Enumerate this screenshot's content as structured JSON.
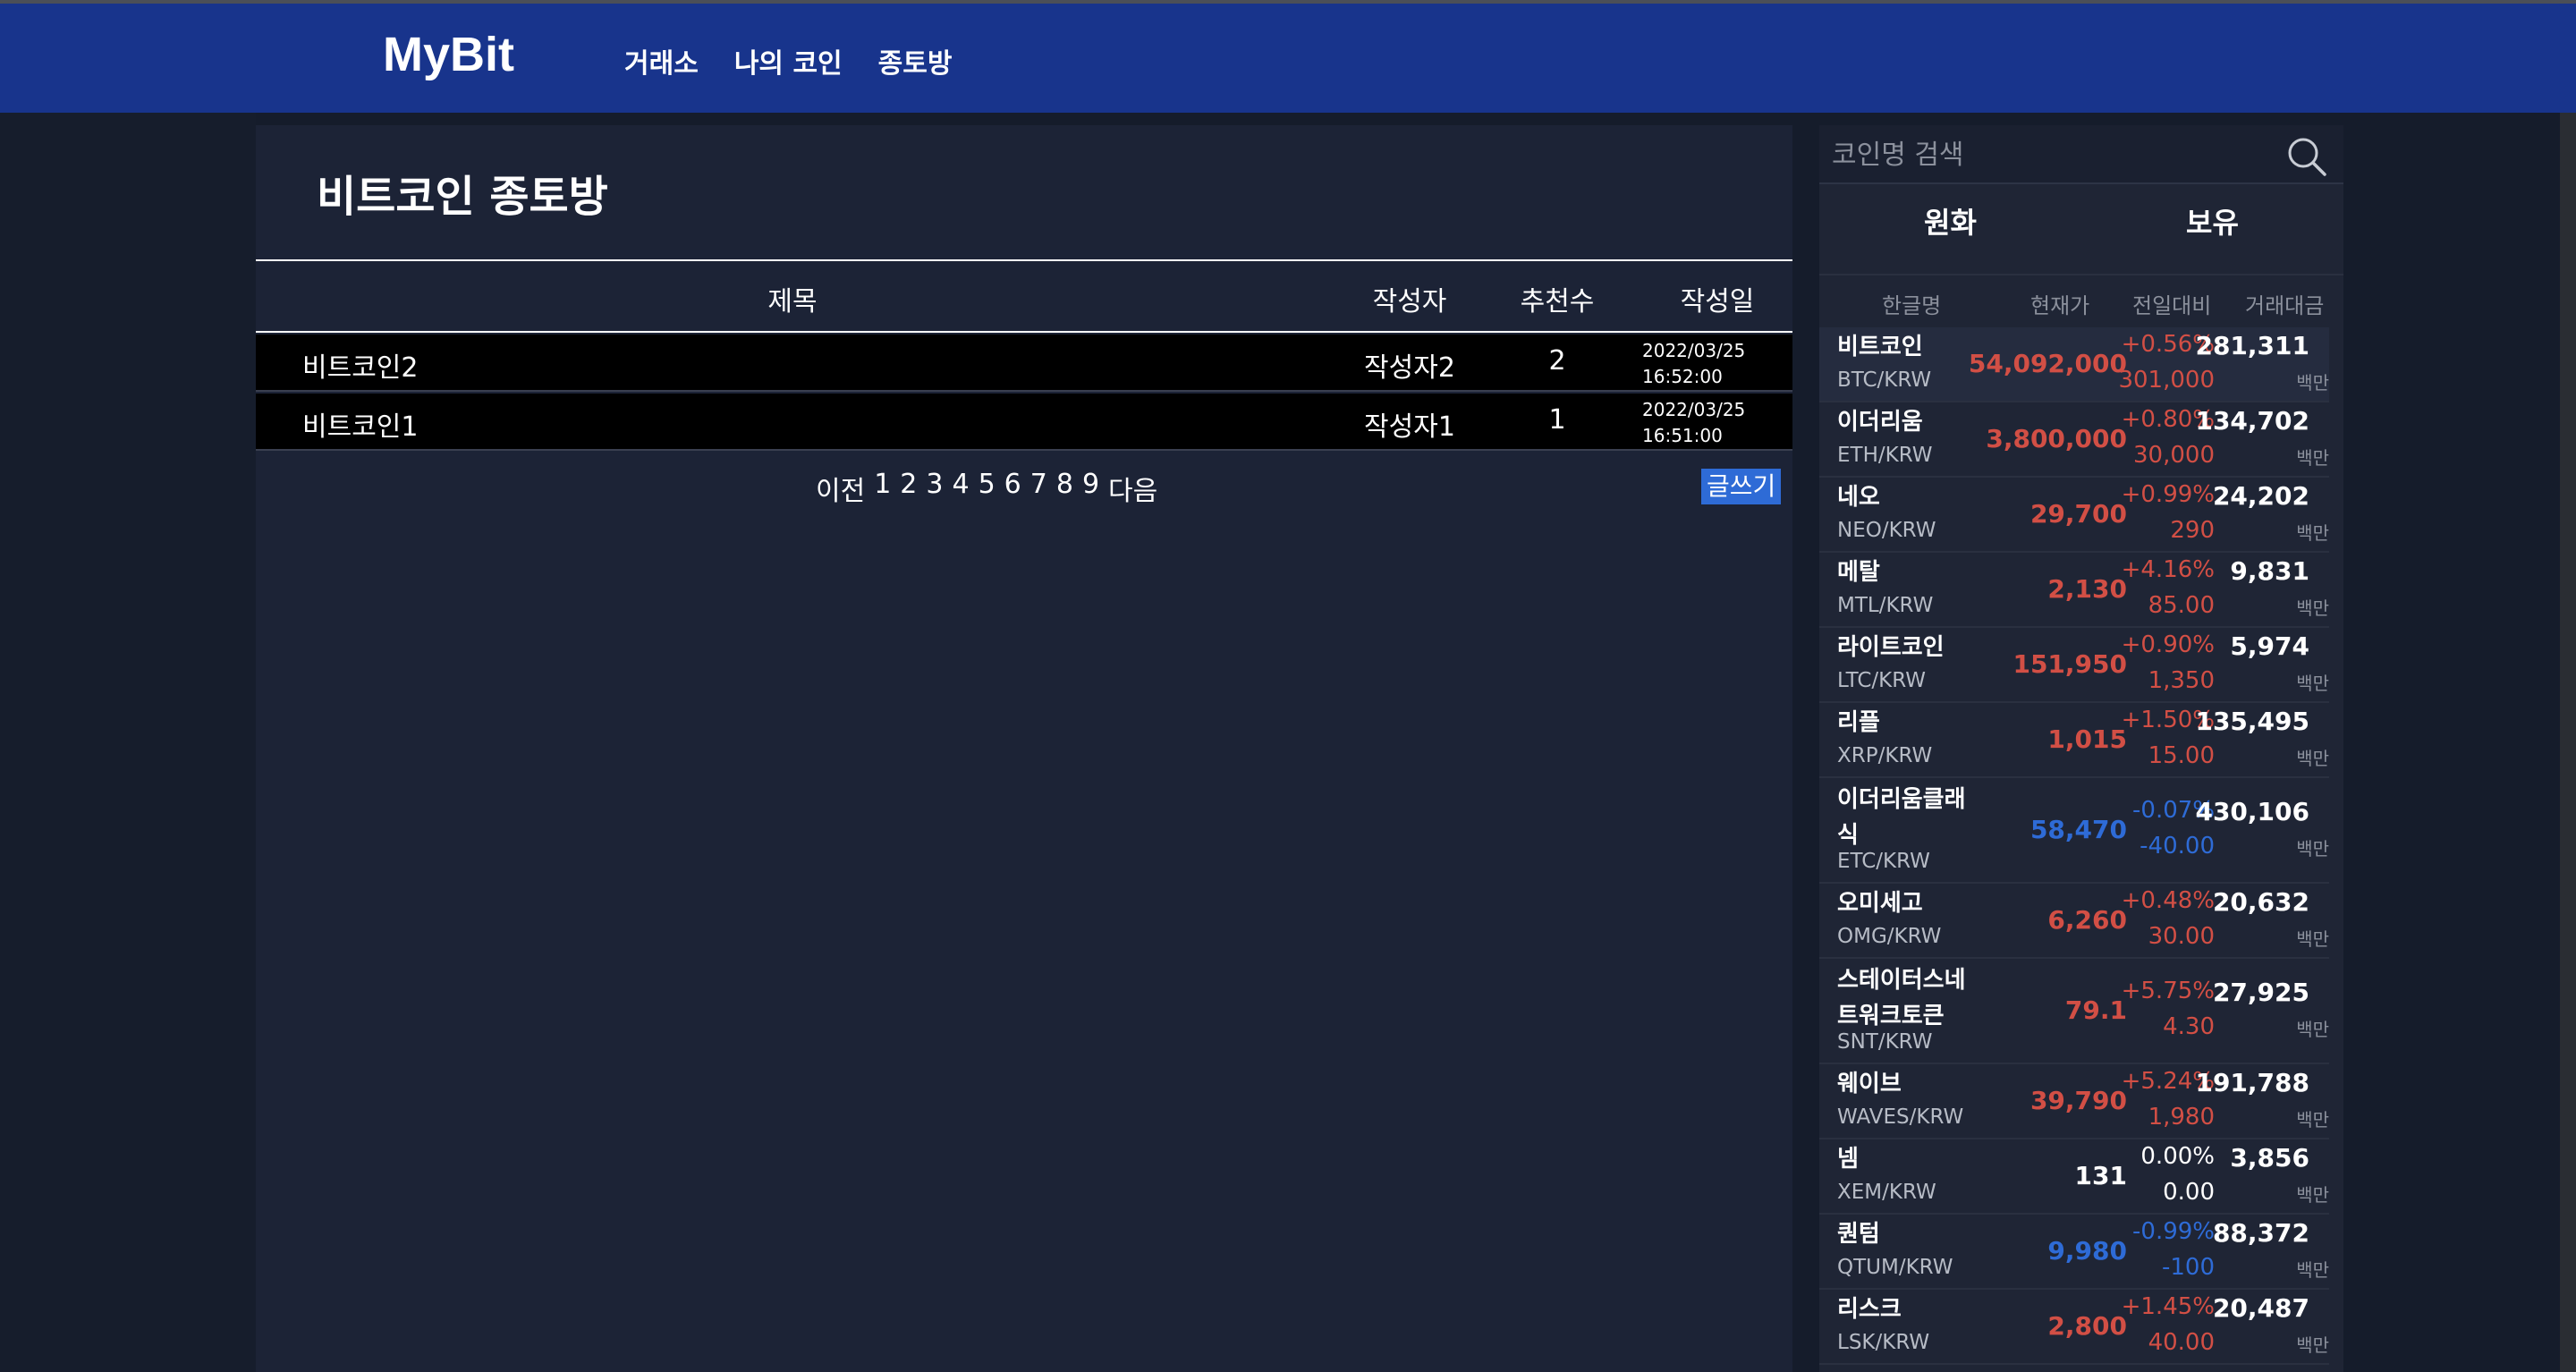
{
  "header": {
    "logo": "MyBit",
    "nav": [
      {
        "label": "거래소"
      },
      {
        "label": "나의 코인"
      },
      {
        "label": "종토방"
      }
    ]
  },
  "board": {
    "title": "비트코인 종토방",
    "columns": {
      "title": "제목",
      "author": "작성자",
      "likes": "추천수",
      "date": "작성일"
    },
    "posts": [
      {
        "title": "비트코인2",
        "author": "작성자2",
        "likes": "2",
        "date": "2022/03/25",
        "time": "16:52:00"
      },
      {
        "title": "비트코인1",
        "author": "작성자1",
        "likes": "1",
        "date": "2022/03/25",
        "time": "16:51:00"
      }
    ],
    "pager": {
      "prev": "이전",
      "pages": [
        "1",
        "2",
        "3",
        "4",
        "5",
        "6",
        "7",
        "8",
        "9"
      ],
      "next": "다음"
    },
    "write_label": "글쓰기"
  },
  "sidebar": {
    "search_placeholder": "코인명 검색",
    "tabs": [
      "원화",
      "보유"
    ],
    "columns": {
      "name": "한글명",
      "price": "현재가",
      "change": "전일대비",
      "volume": "거래대금"
    },
    "coins": [
      {
        "name": "비트코인",
        "symbol": "BTC/KRW",
        "price": "54,092,000",
        "pct": "+0.56%",
        "diff": "301,000",
        "vol": "281,311",
        "unit": "백만",
        "trend": "up"
      },
      {
        "name": "이더리움",
        "symbol": "ETH/KRW",
        "price": "3,800,000",
        "pct": "+0.80%",
        "diff": "30,000",
        "vol": "134,702",
        "unit": "백만",
        "trend": "up"
      },
      {
        "name": "네오",
        "symbol": "NEO/KRW",
        "price": "29,700",
        "pct": "+0.99%",
        "diff": "290",
        "vol": "24,202",
        "unit": "백만",
        "trend": "up"
      },
      {
        "name": "메탈",
        "symbol": "MTL/KRW",
        "price": "2,130",
        "pct": "+4.16%",
        "diff": "85.00",
        "vol": "9,831",
        "unit": "백만",
        "trend": "up"
      },
      {
        "name": "라이트코인",
        "symbol": "LTC/KRW",
        "price": "151,950",
        "pct": "+0.90%",
        "diff": "1,350",
        "vol": "5,974",
        "unit": "백만",
        "trend": "up"
      },
      {
        "name": "리플",
        "symbol": "XRP/KRW",
        "price": "1,015",
        "pct": "+1.50%",
        "diff": "15.00",
        "vol": "135,495",
        "unit": "백만",
        "trend": "up"
      },
      {
        "name": "이더리움클래식",
        "symbol": "ETC/KRW",
        "price": "58,470",
        "pct": "-0.07%",
        "diff": "-40.00",
        "vol": "430,106",
        "unit": "백만",
        "trend": "down"
      },
      {
        "name": "오미세고",
        "symbol": "OMG/KRW",
        "price": "6,260",
        "pct": "+0.48%",
        "diff": "30.00",
        "vol": "20,632",
        "unit": "백만",
        "trend": "up"
      },
      {
        "name": "스테이터스네트워크토큰",
        "symbol": "SNT/KRW",
        "price": "79.1",
        "pct": "+5.75%",
        "diff": "4.30",
        "vol": "27,925",
        "unit": "백만",
        "trend": "up"
      },
      {
        "name": "웨이브",
        "symbol": "WAVES/KRW",
        "price": "39,790",
        "pct": "+5.24%",
        "diff": "1,980",
        "vol": "191,788",
        "unit": "백만",
        "trend": "up"
      },
      {
        "name": "넴",
        "symbol": "XEM/KRW",
        "price": "131",
        "pct": "0.00%",
        "diff": "0.00",
        "vol": "3,856",
        "unit": "백만",
        "trend": "flat"
      },
      {
        "name": "퀀텀",
        "symbol": "QTUM/KRW",
        "price": "9,980",
        "pct": "-0.99%",
        "diff": "-100",
        "vol": "88,372",
        "unit": "백만",
        "trend": "down"
      },
      {
        "name": "리스크",
        "symbol": "LSK/KRW",
        "price": "2,800",
        "pct": "+1.45%",
        "diff": "40.00",
        "vol": "20,487",
        "unit": "백만",
        "trend": "up"
      }
    ]
  },
  "colors": {
    "header": "#18348c",
    "rise": "#d24f45",
    "fall": "#2e6bd6",
    "write_button": "#2e6bd6"
  }
}
